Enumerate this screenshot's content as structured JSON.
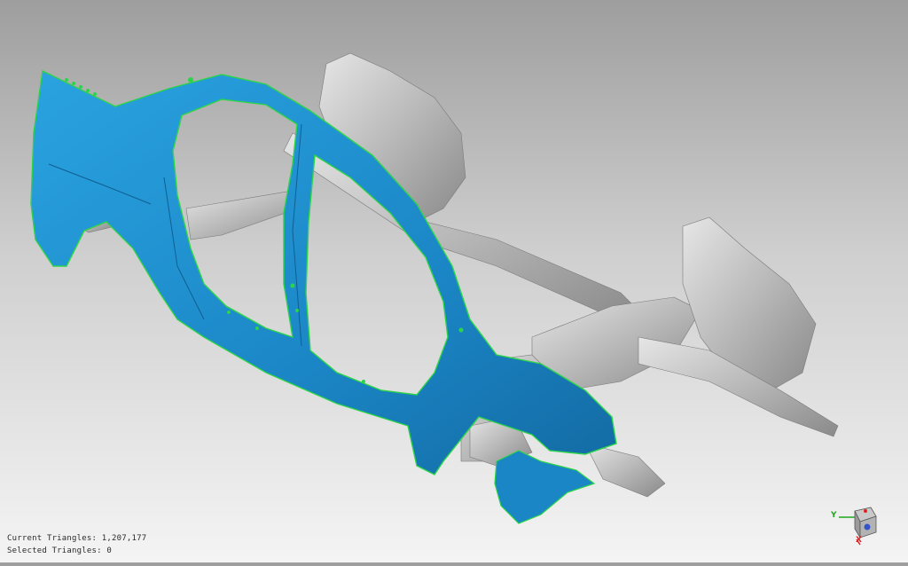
{
  "status": {
    "current_triangles_label": "Current Triangles:",
    "current_triangles_value": "1,207,177",
    "selected_triangles_label": "Selected Triangles:",
    "selected_triangles_value": "0"
  },
  "triad": {
    "y_label": "Y",
    "x_label": "X"
  },
  "colors": {
    "selected_mesh": "#1e8fd0",
    "selected_edge": "#2bd44a",
    "unselected_mesh": "#c8c8c8",
    "background_top": "#9e9e9e",
    "background_bottom": "#f4f4f4"
  }
}
